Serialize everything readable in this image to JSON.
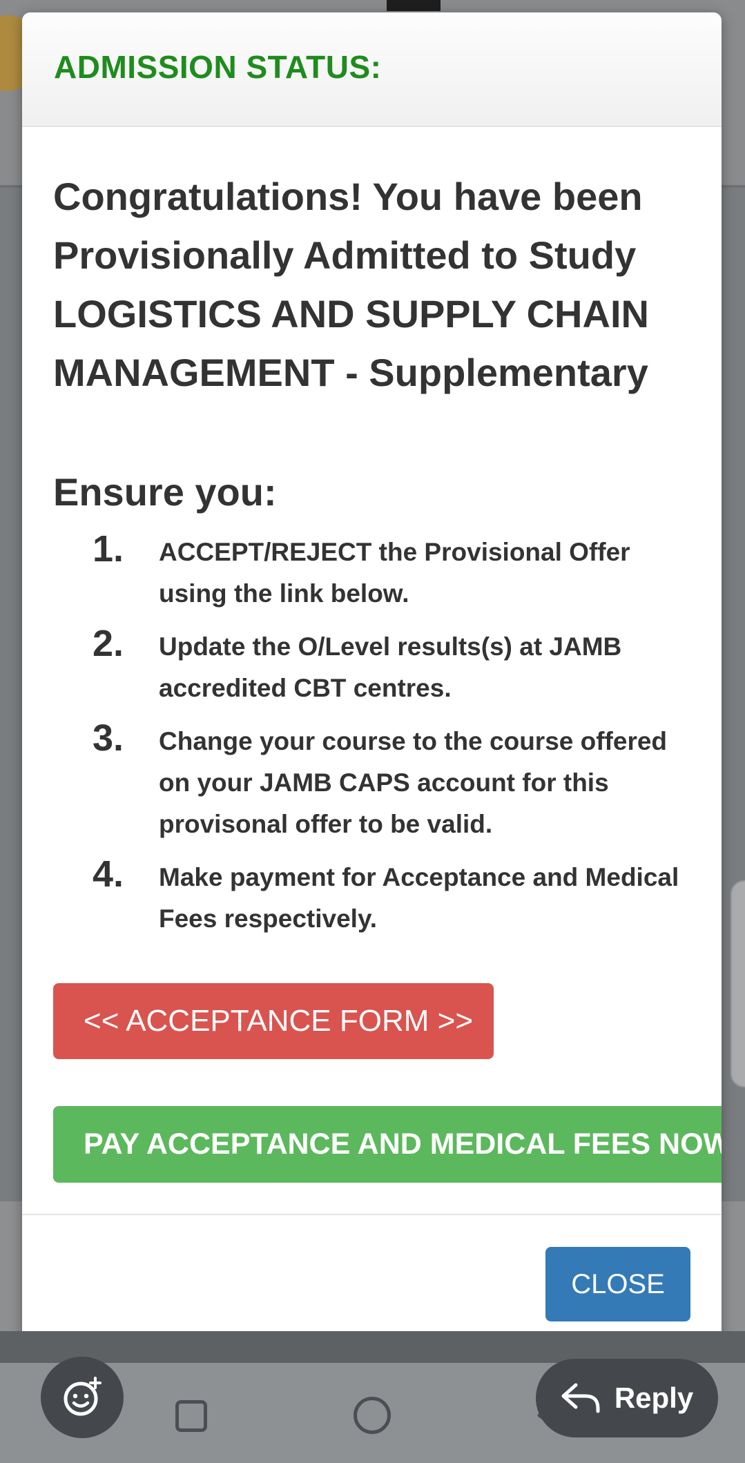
{
  "modal": {
    "title": "ADMISSION STATUS:",
    "intro": "Congratulations! You have been Provisionally Admitted to Study LOGISTICS AND SUPPLY CHAIN MANAGEMENT - Supplementary",
    "ensure_heading": "Ensure you:",
    "steps": [
      {
        "number": "1.",
        "text": "ACCEPT/REJECT the Provisional Offer using the link below."
      },
      {
        "number": "2.",
        "text": "Update the O/Level results(s) at JAMB accredited CBT centres."
      },
      {
        "number": "3.",
        "text": "Change your course to the course offered on your JAMB CAPS account for this provisonal offer to be valid."
      },
      {
        "number": "4.",
        "text": "Make payment for Acceptance and Medical Fees respectively."
      }
    ],
    "acceptance_button": "<< ACCEPTANCE FORM >>",
    "pay_button": "PAY ACCEPTANCE AND MEDICAL FEES NOW >",
    "close_button": "CLOSE"
  },
  "bottom_bar": {
    "reply_label": "Reply",
    "emoji_icon": "emoji-add-icon",
    "reply_icon": "reply-arrow-icon"
  },
  "navigation": {
    "icons": [
      "recents-square-icon",
      "home-circle-icon",
      "back-triangle-icon"
    ]
  },
  "colors": {
    "title_green": "#1e8c1e",
    "acceptance_red": "#d9534f",
    "pay_green": "#5cb85c",
    "close_blue": "#337ab7"
  }
}
